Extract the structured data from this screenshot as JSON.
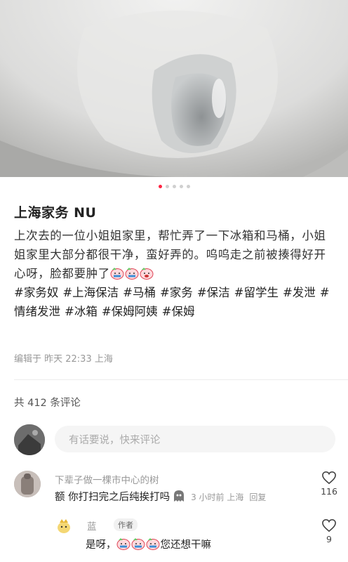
{
  "post": {
    "title": "上海家务 NU",
    "body_text": "上次去的一位小姐姐家里，帮忙弄了一下冰箱和马桶，小姐姐家里大部分都很干净，蛮好弄的。呜呜走之前被揍得好开心呀，脸都要肿了",
    "body_emojis": [
      "crying-face-emoji",
      "crying-face-emoji",
      "crying-face-emoji"
    ],
    "tags": [
      "#家务奴",
      "#上海保洁",
      "#马桶",
      "#家务",
      "#保洁",
      "#留学生",
      "#发泄",
      "#情绪发泄",
      "#冰箱",
      "#保姆阿姨",
      "#保姆"
    ],
    "meta": "编辑于 昨天 22:33 上海",
    "image_count": 5,
    "active_image_index": 0
  },
  "comments_section": {
    "count_label": "共 412 条评论",
    "input_placeholder": "有话要说，快来评论"
  },
  "comments": [
    {
      "user": "下辈子做一棵市中心的树",
      "text": "额 你打扫完之后纯挨打吗",
      "time": "3 小时前 上海",
      "reply_label": "回复",
      "likes": "116"
    },
    {
      "user": "蓝",
      "badge": "作者",
      "text_start": "是呀，",
      "text_end": "您还想干嘛",
      "likes": "9"
    }
  ],
  "colors": {
    "accent": "#ff2442",
    "text": "#222222",
    "muted": "#999999"
  }
}
